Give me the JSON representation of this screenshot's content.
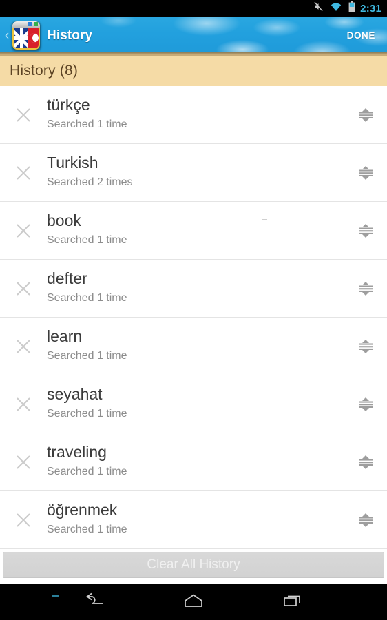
{
  "statusbar": {
    "time": "2:31",
    "icons": [
      "mute-icon",
      "wifi-icon",
      "battery-icon"
    ]
  },
  "appbar": {
    "back_label": "‹",
    "logo_name": "english-turkish-dictionary-logo",
    "title": "History",
    "done_label": "DONE",
    "background_color": "#22a0de"
  },
  "section": {
    "title": "History (8)",
    "background_color": "#f5dba6",
    "text_color": "#5c4324"
  },
  "list": {
    "items": [
      {
        "term": "türkçe",
        "count": "Searched 1 time"
      },
      {
        "term": "Turkish",
        "count": "Searched 2 times"
      },
      {
        "term": "book",
        "count": "Searched 1 time"
      },
      {
        "term": "defter",
        "count": "Searched 1 time"
      },
      {
        "term": "learn",
        "count": "Searched 1 time"
      },
      {
        "term": "seyahat",
        "count": "Searched 1 time"
      },
      {
        "term": "traveling",
        "count": "Searched 1 time"
      },
      {
        "term": "öğrenmek",
        "count": "Searched 1 time"
      }
    ],
    "delete_icon": "close-x-icon",
    "reorder_icon": "drag-handle-icon"
  },
  "footer": {
    "clear_label": "Clear All History",
    "clear_enabled": false
  },
  "navbar": {
    "buttons": [
      "back-icon",
      "home-icon",
      "recents-icon"
    ]
  }
}
